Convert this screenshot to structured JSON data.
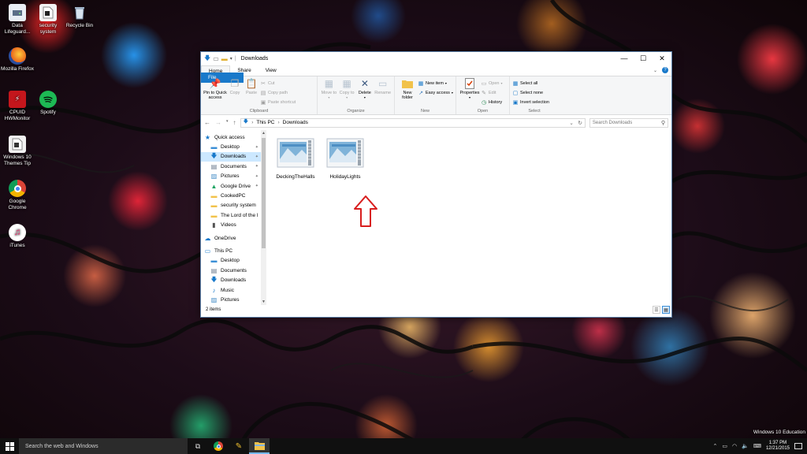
{
  "desktop": {
    "icons": [
      {
        "label": "Data Lifeguard..."
      },
      {
        "label": "security system"
      },
      {
        "label": "Recycle Bin"
      },
      {
        "label": "Mozilla Firefox"
      },
      {
        "label": "CPUID HWMonitor"
      },
      {
        "label": "Spotify"
      },
      {
        "label": "Windows 10 Themes Tip"
      },
      {
        "label": "Google Chrome"
      },
      {
        "label": "iTunes"
      }
    ],
    "watermark": "Windows 10 Education"
  },
  "window": {
    "title": "Downloads",
    "controls": {
      "minimize": "—",
      "maximize": "☐",
      "close": "✕"
    },
    "tabs": [
      {
        "label": "File"
      },
      {
        "label": "Home"
      },
      {
        "label": "Share"
      },
      {
        "label": "View"
      }
    ],
    "help": "?",
    "ribbon": {
      "clipboard": {
        "label": "Clipboard",
        "pin": "Pin to Quick access",
        "copy": "Copy",
        "paste": "Paste",
        "cut": "Cut",
        "copy_path": "Copy path",
        "paste_shortcut": "Paste shortcut"
      },
      "organize": {
        "label": "Organize",
        "move_to": "Move to",
        "copy_to": "Copy to",
        "delete": "Delete",
        "rename": "Rename"
      },
      "new": {
        "label": "New",
        "new_folder": "New folder",
        "new_item": "New item",
        "easy_access": "Easy access"
      },
      "open": {
        "label": "Open",
        "properties": "Properties",
        "open": "Open",
        "edit": "Edit",
        "history": "History"
      },
      "select": {
        "label": "Select",
        "select_all": "Select all",
        "select_none": "Select none",
        "invert": "Invert selection"
      }
    },
    "address": {
      "crumbs": [
        "This PC",
        "Downloads"
      ],
      "search_placeholder": "Search Downloads"
    },
    "nav": [
      {
        "label": "Quick access"
      },
      {
        "label": "Desktop"
      },
      {
        "label": "Downloads"
      },
      {
        "label": "Documents"
      },
      {
        "label": "Pictures"
      },
      {
        "label": "Google Drive"
      },
      {
        "label": "CookedPC"
      },
      {
        "label": "security system"
      },
      {
        "label": "The Lord of the I"
      },
      {
        "label": "Videos"
      },
      {
        "label": "OneDrive"
      },
      {
        "label": "This PC"
      },
      {
        "label": "Desktop"
      },
      {
        "label": "Documents"
      },
      {
        "label": "Downloads"
      },
      {
        "label": "Music"
      },
      {
        "label": "Pictures"
      }
    ],
    "files": [
      {
        "name": "DeckingTheHalls"
      },
      {
        "name": "HolidayLights"
      }
    ],
    "status": "2 items"
  },
  "taskbar": {
    "search_placeholder": "Search the web and Windows",
    "time": "1:37 PM",
    "date": "12/21/2015"
  },
  "colors": {
    "accent": "#1979ca",
    "selection": "#cce8ff",
    "annotation_arrow": "#d81e1e"
  }
}
